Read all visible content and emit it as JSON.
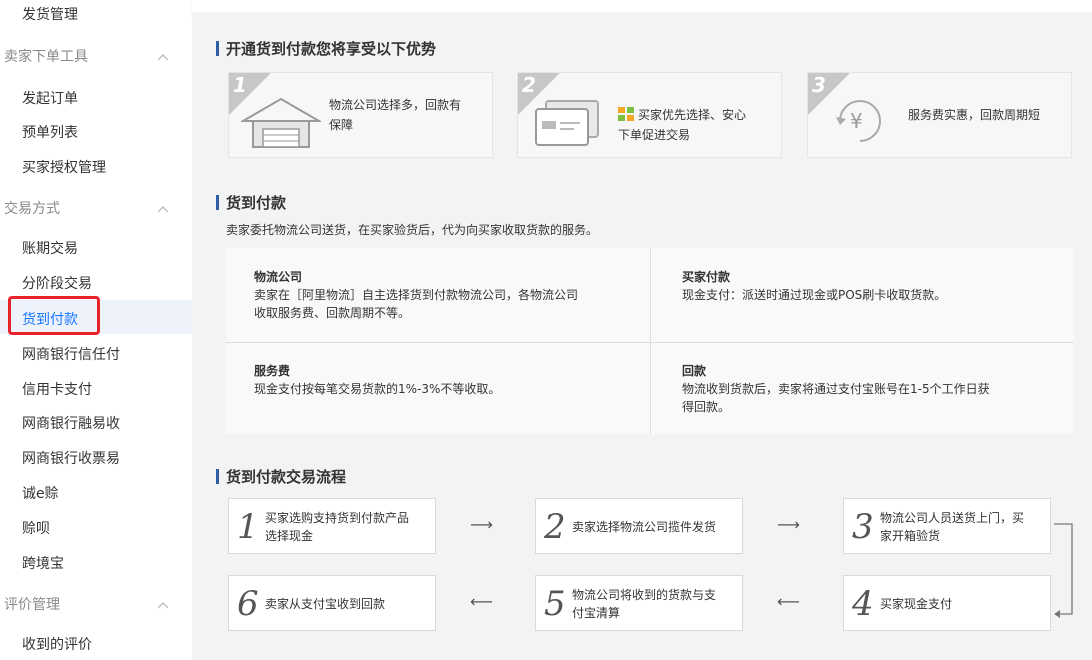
{
  "sidebar": {
    "items": [
      {
        "label": "发货管理"
      },
      {
        "label": "卖家下单工具",
        "group": true
      },
      {
        "label": "发起订单"
      },
      {
        "label": "预单列表"
      },
      {
        "label": "买家授权管理"
      },
      {
        "label": "交易方式",
        "group": true
      },
      {
        "label": "账期交易"
      },
      {
        "label": "分阶段交易"
      },
      {
        "label": "货到付款",
        "active": true
      },
      {
        "label": "网商银行信任付"
      },
      {
        "label": "信用卡支付"
      },
      {
        "label": "网商银行融易收"
      },
      {
        "label": "网商银行收票易"
      },
      {
        "label": "诚e赊"
      },
      {
        "label": "赊呗"
      },
      {
        "label": "跨境宝"
      },
      {
        "label": "评价管理",
        "group": true
      },
      {
        "label": "收到的评价"
      }
    ]
  },
  "advantages": {
    "title": "开通货到付款您将享受以下优势",
    "cards": [
      {
        "num": "1",
        "text_line1": "物流公司选择多，回款有",
        "text_line2": "保障",
        "icon": "warehouse-icon"
      },
      {
        "num": "2",
        "text_line1": "买家优先选择、安心",
        "text_line2": "下单促进交易",
        "icon": "card-icon"
      },
      {
        "num": "3",
        "text_line1": "服务费实惠，回款周期短",
        "text_line2": "",
        "icon": "yen-icon"
      }
    ]
  },
  "cod": {
    "title": "货到付款",
    "desc": "卖家委托物流公司送货，在买家验货后，代为向买家收取货款的服务。",
    "cells": [
      {
        "title": "物流公司",
        "line1": "卖家在［阿里物流］自主选择货到付款物流公司，各物流公司",
        "line2": "收取服务费、回款周期不等。"
      },
      {
        "title": "买家付款",
        "line1": "现金支付：派送时通过现金或POS刷卡收取货款。",
        "line2": ""
      },
      {
        "title": "服务费",
        "line1": "现金支付按每笔交易货款的1%-3%不等收取。",
        "line2": ""
      },
      {
        "title": "回款",
        "line1": "物流收到货款后，卖家将通过支付宝账号在1-5个工作日获",
        "line2": "得回款。"
      }
    ]
  },
  "flow": {
    "title": "货到付款交易流程",
    "steps": [
      {
        "num": "1",
        "line1": "买家选购支持货到付款产品",
        "line2": "选择现金"
      },
      {
        "num": "2",
        "line1": "卖家选择物流公司揽件发货",
        "line2": ""
      },
      {
        "num": "3",
        "line1": "物流公司人员送货上门，买",
        "line2": "家开箱验货"
      },
      {
        "num": "4",
        "line1": "买家现金支付",
        "line2": ""
      },
      {
        "num": "5",
        "line1": "物流公司将收到的货款与支",
        "line2": "付宝清算"
      },
      {
        "num": "6",
        "line1": "卖家从支付宝收到回款",
        "line2": ""
      }
    ],
    "arrow_right": "⟶",
    "arrow_left": "⟵"
  },
  "colors": {
    "accent": "#1677ff",
    "highlight": "#e8242a",
    "title_bar": "#2f5da8"
  }
}
